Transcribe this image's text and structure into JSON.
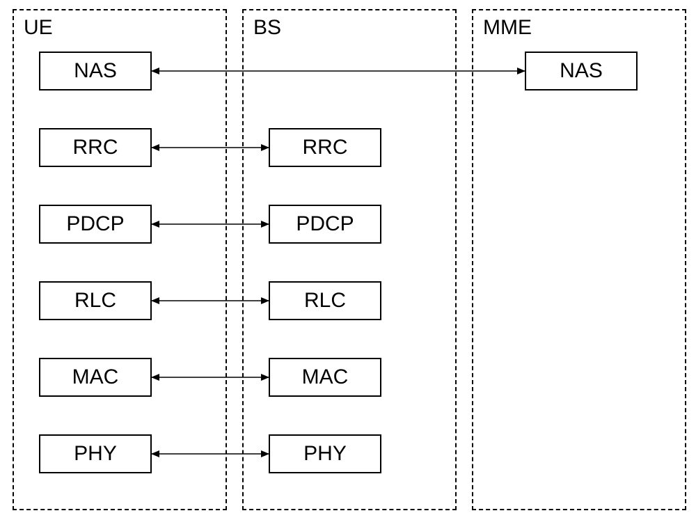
{
  "columns": {
    "ue": {
      "label": "UE"
    },
    "bs": {
      "label": "BS"
    },
    "mme": {
      "label": "MME"
    }
  },
  "layers": {
    "nas": "NAS",
    "rrc": "RRC",
    "pdcp": "PDCP",
    "rlc": "RLC",
    "mac": "MAC",
    "phy": "PHY"
  },
  "connections": [
    {
      "from": "ue.nas",
      "to": "mme.nas"
    },
    {
      "from": "ue.rrc",
      "to": "bs.rrc"
    },
    {
      "from": "ue.pdcp",
      "to": "bs.pdcp"
    },
    {
      "from": "ue.rlc",
      "to": "bs.rlc"
    },
    {
      "from": "ue.mac",
      "to": "bs.mac"
    },
    {
      "from": "ue.phy",
      "to": "bs.phy"
    }
  ]
}
